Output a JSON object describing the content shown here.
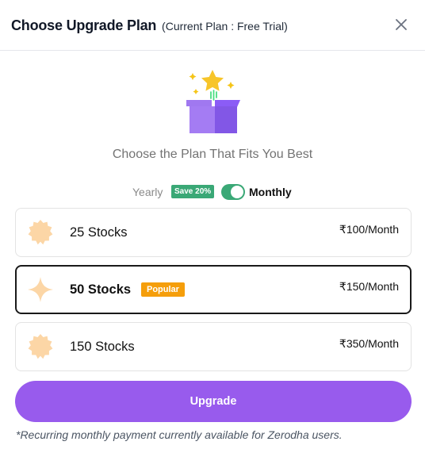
{
  "dialog": {
    "title": "Choose Upgrade Plan",
    "subtitle": "(Current Plan : Free Trial)",
    "close_icon": "close-icon"
  },
  "hero": {
    "icon": "gift-box-star-icon",
    "tagline": "Choose the Plan That Fits You Best"
  },
  "billing": {
    "yearly_label": "Yearly",
    "save_badge": "Save 20%",
    "monthly_label": "Monthly",
    "selected": "monthly"
  },
  "plans": [
    {
      "name": "25 Stocks",
      "price": "₹100/Month",
      "badge": "",
      "selected": false,
      "icon": "badge-icon"
    },
    {
      "name": "50 Stocks",
      "price": "₹150/Month",
      "badge": "Popular",
      "selected": true,
      "icon": "sparkle-star-icon"
    },
    {
      "name": "150 Stocks",
      "price": "₹350/Month",
      "badge": "",
      "selected": false,
      "icon": "badge-icon"
    }
  ],
  "actions": {
    "upgrade_label": "Upgrade"
  },
  "footnote": "*Recurring monthly payment currently available for Zerodha users.",
  "colors": {
    "accent_purple": "#985bed",
    "toggle_green": "#3aa876",
    "popular_orange": "#f59e0b",
    "icon_peach": "#fcd6a6"
  }
}
